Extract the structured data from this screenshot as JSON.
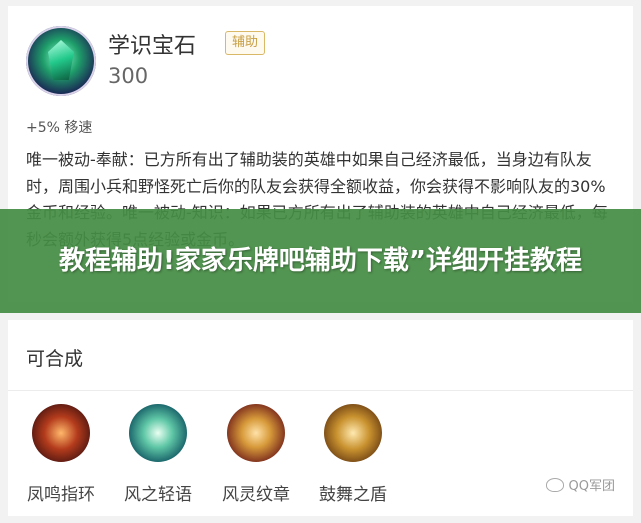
{
  "item": {
    "name": "学识宝石",
    "tag": "辅助",
    "price": "300",
    "stat": "+5% 移速",
    "description": "唯一被动-奉献：已方所有出了辅助装的英雄中如果自己经济最低，当身边有队友时，周围小兵和野怪死亡后你的队友会获得全额收益，你会获得不影响队友的30%金币和经验。唯一被动-知识：如果已方所有出了辅助装的英雄中自己经济最低，每秒会额外获得5点经验或金币。"
  },
  "banner": {
    "text": "教程辅助!家家乐牌吧辅助下载”详细开挂教程"
  },
  "compose": {
    "title": "可合成",
    "items": [
      {
        "label": "凤鸣指环",
        "icon": "ring-icon"
      },
      {
        "label": "风之轻语",
        "icon": "wind-icon"
      },
      {
        "label": "风灵纹章",
        "icon": "emblem-icon"
      },
      {
        "label": "鼓舞之盾",
        "icon": "shield-icon"
      }
    ]
  },
  "watermark": {
    "text": "QQ军团"
  }
}
